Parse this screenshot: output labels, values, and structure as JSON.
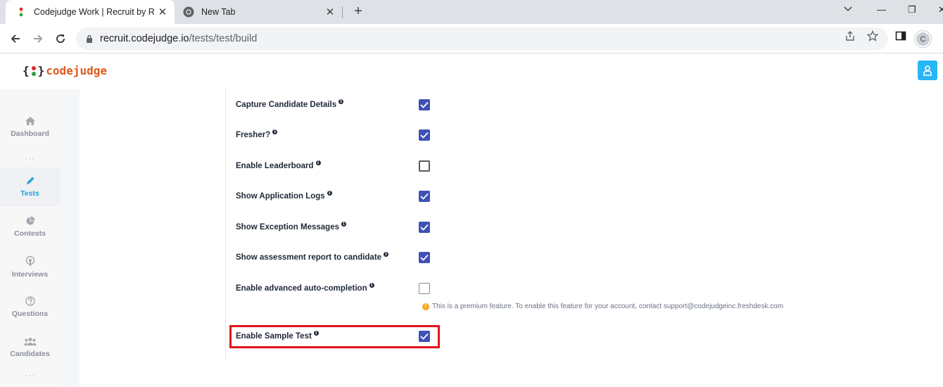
{
  "browser": {
    "tabs": [
      {
        "title": "Codejudge Work | Recruit by Rea",
        "close": "✕",
        "active": true
      },
      {
        "title": "New Tab",
        "close": "✕",
        "active": false
      }
    ],
    "new_tab": "+",
    "window_controls": {
      "minimize": "—",
      "restore": "❐",
      "close": "✕"
    },
    "address": {
      "host": "recruit.codejudge.io",
      "path": "/tests/test/build"
    },
    "profile_initial": "C"
  },
  "app": {
    "logo": {
      "open_brace": "{",
      "close_brace": "}",
      "word": "codejudge",
      "colors": [
        "#e02424",
        "#f4b400",
        "#2e9e41"
      ]
    },
    "brand_color": "#e2581b",
    "accent": "#29b6f6"
  },
  "sidebar": {
    "items": [
      {
        "label": "Dashboard",
        "icon": "home-icon",
        "active": false
      },
      {
        "label": "Tests",
        "icon": "pencil-icon",
        "active": true
      },
      {
        "label": "Contests",
        "icon": "pie-chart-icon",
        "active": false
      },
      {
        "label": "Interviews",
        "icon": "podcast-icon",
        "active": false
      },
      {
        "label": "Questions",
        "icon": "question-icon",
        "active": false
      },
      {
        "label": "Candidates",
        "icon": "users-icon",
        "active": false
      }
    ],
    "more": "···"
  },
  "settings": [
    {
      "label": "Capture Candidate Details",
      "checked": true
    },
    {
      "label": "Fresher?",
      "checked": true
    },
    {
      "label": "Enable Leaderboard",
      "checked": false
    },
    {
      "label": "Show Application Logs",
      "checked": true
    },
    {
      "label": "Show Exception Messages",
      "checked": true
    },
    {
      "label": "Show assessment report to candidate",
      "checked": true
    },
    {
      "label": "Enable advanced auto-completion",
      "checked": false
    },
    {
      "label": "Enable Sample Test",
      "checked": true
    }
  ],
  "info_glyph": "i",
  "premium_icon": "!",
  "premium_note": "This is a premium feature. To enable this feature for your account, contact support@codejudgeinc.freshdesk.com",
  "checkbox_color": "#3f51b5",
  "highlight_color": "#e3141b"
}
